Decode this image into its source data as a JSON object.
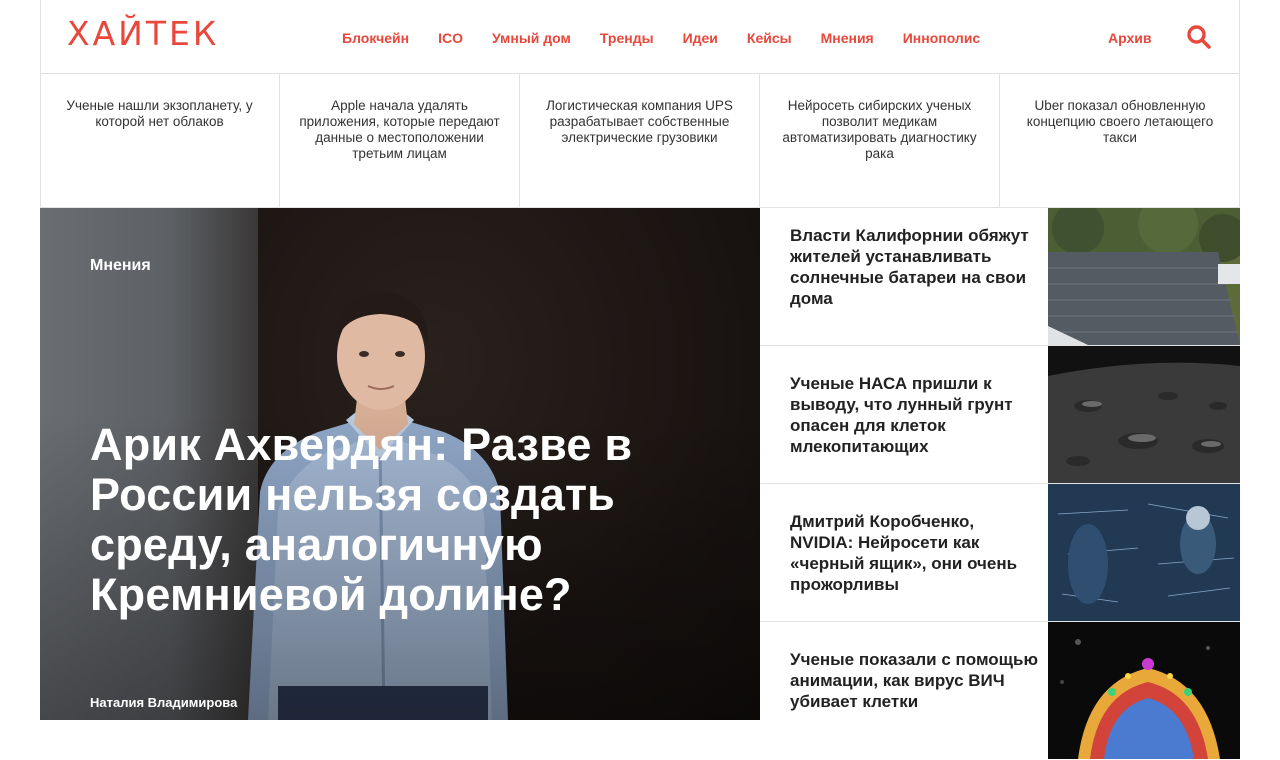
{
  "brand": {
    "logo": "ХАЙТЕК",
    "accent": "#e8473b"
  },
  "nav": {
    "items": [
      "Блокчейн",
      "ICO",
      "Умный дом",
      "Тренды",
      "Идеи",
      "Кейсы",
      "Мнения",
      "Иннополис"
    ],
    "archive": "Архив",
    "search_icon": "search-icon"
  },
  "ticker": [
    "Ученые нашли экзопланету, у которой нет облаков",
    "Apple начала удалять приложения, которые передают данные о местоположении третьим лицам",
    "Логистическая компания UPS разрабатывает собственные электрические грузовики",
    "Нейросеть сибирских ученых позволит медикам автоматизировать диагностику рака",
    "Uber показал обновленную концепцию своего летающего такси"
  ],
  "hero": {
    "category": "Мнения",
    "title": "Арик Ахвердян: Разве в России нельзя создать среду, аналогичную Кремниевой долине?",
    "author": "Наталия Владимирова"
  },
  "side": [
    {
      "title": "Власти Калифорнии обяжут жителей устанавливать солнечные батареи на свои дома"
    },
    {
      "title": "Ученые НАСА пришли к выводу, что лунный грунт опасен для клеток млекопитающих"
    },
    {
      "title": "Дмитрий Коробченко, NVIDIA: Нейросети как «черный ящик», они очень прожорливы"
    },
    {
      "title": "Ученые показали с помощью анимации, как вирус ВИЧ убивает клетки"
    }
  ]
}
